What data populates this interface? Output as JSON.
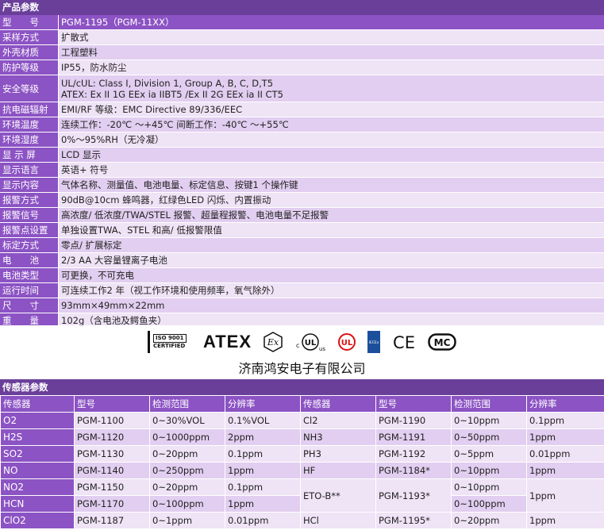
{
  "params_section": {
    "title": "产品参数",
    "rows": [
      {
        "label": "型　　号",
        "value": [
          "PGM-1195（PGM-11XX）"
        ]
      },
      {
        "label": "采样方式",
        "value": [
          "扩散式"
        ]
      },
      {
        "label": "外壳材质",
        "value": [
          "工程塑料"
        ]
      },
      {
        "label": "防护等级",
        "value": [
          "IP55，防水防尘"
        ]
      },
      {
        "label": "安全等级",
        "value": [
          "UL/cUL: Class I, Division 1, Group A, B, C, D,T5",
          "ATEX: Ex II 1G EEx ia IIBT5 /Ex II 2G EEx ia II CT5"
        ]
      },
      {
        "label": "抗电磁辐射",
        "value": [
          "EMI/RF 等级：EMC Directive 89/336/EEC"
        ]
      },
      {
        "label": "环境温度",
        "value": [
          "连续工作：-20℃ ～+45℃ 间断工作：-40℃ ～+55℃"
        ]
      },
      {
        "label": "环境湿度",
        "value": [
          "0%～95%RH（无冷凝）"
        ]
      },
      {
        "label": "显 示 屏",
        "value": [
          "LCD 显示"
        ]
      },
      {
        "label": "显示语言",
        "value": [
          "英语+ 符号"
        ]
      },
      {
        "label": "显示内容",
        "value": [
          "气体名称、测量值、电池电量、标定信息、按键1 个操作键"
        ]
      },
      {
        "label": "报警方式",
        "value": [
          "90dB@10cm 蜂鸣器，红绿色LED 闪烁、内置振动"
        ]
      },
      {
        "label": "报警信号",
        "value": [
          "高浓度/ 低浓度/TWA/STEL 报警、超量程报警、电池电量不足报警"
        ]
      },
      {
        "label": "报警点设置",
        "value": [
          "单独设置TWA、STEL 和高/ 低报警限值"
        ]
      },
      {
        "label": "标定方式",
        "value": [
          "零点/ 扩展标定"
        ]
      },
      {
        "label": "电　　池",
        "value": [
          "2/3 AA 大容量锂离子电池"
        ]
      },
      {
        "label": "电池类型",
        "value": [
          "可更换，不可充电"
        ]
      },
      {
        "label": "运行时间",
        "value": [
          "可连续工作2 年（视工作环境和使用频率，氧气除外）"
        ]
      },
      {
        "label": "尺　　寸",
        "value": [
          "93mm×49mm×22mm"
        ]
      },
      {
        "label": "重　　量",
        "value": [
          "102g（含电池及鳄鱼夹）"
        ]
      }
    ]
  },
  "certifications": {
    "iso_line1": "ISO 9001",
    "iso_line2": "CERTIFIED",
    "atex": "ATEX",
    "ex": "Ex",
    "ul_c": "c",
    "ul_us": "us",
    "ul_text": "UL",
    "iecex": "IECEx",
    "ce": "CE",
    "mc": "MC"
  },
  "company": "济南鸿安电子有限公司",
  "sensor_section": {
    "title": "传感器参数",
    "headers": [
      "传感器",
      "型号",
      "检测范围",
      "分辨率",
      "传感器",
      "型号",
      "检测范围",
      "分辨率"
    ],
    "left": [
      {
        "gas": "O2",
        "model": "PGM-1100",
        "range": "0~30%VOL",
        "res": "0.1%VOL"
      },
      {
        "gas": "H2S",
        "model": "PGM-1120",
        "range": "0~1000ppm",
        "res": "2ppm"
      },
      {
        "gas": "SO2",
        "model": "PGM-1130",
        "range": "0~20ppm",
        "res": "0.1ppm"
      },
      {
        "gas": "NO",
        "model": "PGM-1140",
        "range": "0~250ppm",
        "res": "1ppm"
      },
      {
        "gas": "NO2",
        "model": "PGM-1150",
        "range": "0~20ppm",
        "res": "0.1ppm"
      },
      {
        "gas": "HCN",
        "model": "PGM-1170",
        "range": "0~100ppm",
        "res": "1ppm"
      },
      {
        "gas": "ClO2",
        "model": "PGM-1187",
        "range": "0~1ppm",
        "res": "0.01ppm"
      }
    ],
    "right": [
      {
        "gas": "Cl2",
        "model": "PGM-1190",
        "range": "0~10ppm",
        "res": "0.1ppm"
      },
      {
        "gas": "NH3",
        "model": "PGM-1191",
        "range": "0~50ppm",
        "res": "1ppm"
      },
      {
        "gas": "PH3",
        "model": "PGM-1192",
        "range": "0~5ppm",
        "res": "0.01ppm"
      },
      {
        "gas": "HF",
        "model": "PGM-1184*",
        "range": "0~10ppm",
        "res": "1ppm"
      },
      {
        "gas": "ETO-B**",
        "model": "PGM-1193*",
        "range_a": "0~10ppm",
        "range_b": "0~100ppm",
        "res": "1ppm"
      },
      {
        "gas": "HCl",
        "model": "PGM-1195*",
        "range": "0~20ppm",
        "res": "1ppm"
      }
    ]
  }
}
